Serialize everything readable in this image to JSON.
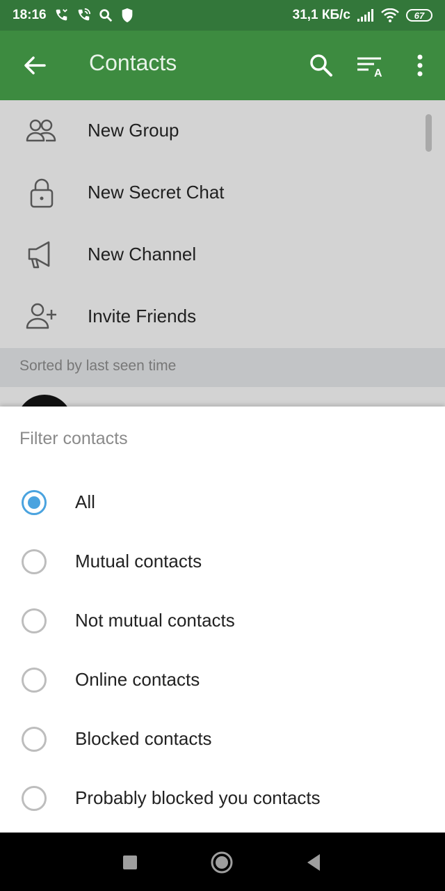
{
  "status_bar": {
    "time": "18:16",
    "left_icons": [
      "missed-call-icon",
      "wifi-call-icon",
      "search-icon",
      "shield-icon"
    ],
    "network_speed": "31,1 КБ/с",
    "right_icons": [
      "signal-icon",
      "wifi-icon"
    ],
    "battery": "67"
  },
  "app_bar": {
    "title": "Contacts",
    "actions": [
      "search-icon",
      "sort-icon",
      "more-vert-icon"
    ]
  },
  "menu": {
    "items": [
      {
        "label": "New Group",
        "icon": "group-icon"
      },
      {
        "label": "New Secret Chat",
        "icon": "lock-icon"
      },
      {
        "label": "New Channel",
        "icon": "megaphone-icon"
      },
      {
        "label": "Invite Friends",
        "icon": "add-person-icon"
      }
    ]
  },
  "section": {
    "header": "Sorted by last seen time"
  },
  "filter_sheet": {
    "title": "Filter contacts",
    "selected_index": 0,
    "options": [
      "All",
      "Mutual contacts",
      "Not mutual contacts",
      "Online contacts",
      "Blocked contacts",
      "Probably blocked you contacts"
    ]
  },
  "colors": {
    "status_bar": "#33773a",
    "app_bar": "#3d8b40",
    "radio_accent": "#4aa3df"
  }
}
